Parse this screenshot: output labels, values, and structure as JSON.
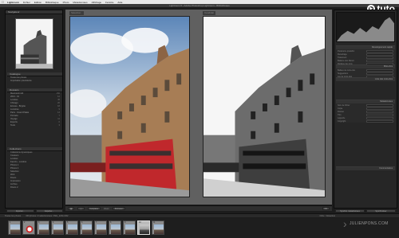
{
  "menubar": {
    "app": "Lightroom",
    "items": [
      "Fichier",
      "Edition",
      "Bibliothèque",
      "Photo",
      "Métadonnées",
      "Affichage",
      "Fenêtre",
      "Aide"
    ]
  },
  "window": {
    "title": "Lightroom 5 - Adobe Photoshop Lightroom - Bibliothèque"
  },
  "watermark": {
    "brand": "tuto"
  },
  "credit": {
    "text": "JULIENPONS.COM"
  },
  "left_panel": {
    "navigator_label": "Navigateur",
    "catalog_label": "Catalogue",
    "catalog_items": [
      "Toutes les photos",
      "Importation précédente"
    ],
    "folders_label": "Dossiers",
    "folders": [
      {
        "name": "Macintosh HD",
        "count": "150"
      },
      {
        "name": "2013 - 01",
        "count": "12"
      },
      {
        "name": "Londres",
        "count": "45"
      },
      {
        "name": "Chicago",
        "count": "20"
      },
      {
        "name": "Ecosse - Brigitte",
        "count": "18"
      },
      {
        "name": "Lumières",
        "count": "9"
      },
      {
        "name": "Paris - Grand Palais",
        "count": "14"
      },
      {
        "name": "Portraits",
        "count": "7"
      },
      {
        "name": "Voyage",
        "count": "11"
      },
      {
        "name": "Exports",
        "count": "6"
      },
      {
        "name": "Tests",
        "count": "3"
      }
    ],
    "collections_label": "Collections",
    "collections": [
      "Collections dynamiques",
      "Couleurs",
      "Londres",
      "Favoris - Londres",
      "Photos 1",
      "Photos 2",
      "Sélection",
      "Web",
      "Divers",
      "Impression",
      "Archive",
      "Divers 2"
    ]
  },
  "compare": {
    "select_label": "Sélection",
    "candidate_label": "Candidat"
  },
  "right_panel": {
    "quick_develop_label": "Développement rapide",
    "quick_develop_rows": [
      "Paramètre prédéfini",
      "Recadrage",
      "Traitement",
      "Balance des blancs",
      "Réglage des tons"
    ],
    "keywords_label": "Mots-clés",
    "keyword_rows": [
      "Balises de mots-clés",
      "Suggestions",
      "Jeu de mots-clés"
    ],
    "keyword_list_label": "Liste des mots-clés",
    "metadata_label": "Métadonnées",
    "metadata_rows": [
      "Nom de fichier",
      "Copie",
      "Dossier",
      "Titre",
      "Légende",
      "Copyright"
    ],
    "comments_label": "Commentaires"
  },
  "toolbar": {
    "compare_label": "Comparer",
    "swap_label": "Permuter",
    "zoom_label": "Zoom",
    "done_label": "OK"
  },
  "footer": {
    "import_label": "Importer...",
    "export_label": "Exporter...",
    "sync_meta_label": "Synchro. métadonnées",
    "sync_label": "Synchroniser"
  },
  "filmbar": {
    "source": "Toutes les photos",
    "info": "150 photos / 2 sélectionnées / IMG_1234.CR2",
    "filter": "Filtre : Désactivé"
  },
  "filmstrip": {
    "thumbs": [
      {
        "num": "1",
        "style": "plain"
      },
      {
        "num": "2",
        "style": "red"
      },
      {
        "num": "3",
        "style": "plain"
      },
      {
        "num": "4",
        "style": "plain"
      },
      {
        "num": "5",
        "style": "plain"
      },
      {
        "num": "6",
        "style": "plain"
      },
      {
        "num": "7",
        "style": "plain"
      },
      {
        "num": "8",
        "style": "plain"
      },
      {
        "num": "9",
        "style": "plain"
      },
      {
        "num": "10",
        "style": "bw"
      },
      {
        "num": "11",
        "style": "plain"
      }
    ]
  },
  "colors": {
    "accent": "#5b8fc9",
    "bus_red": "#c0282c",
    "panel_bg": "#262626"
  }
}
